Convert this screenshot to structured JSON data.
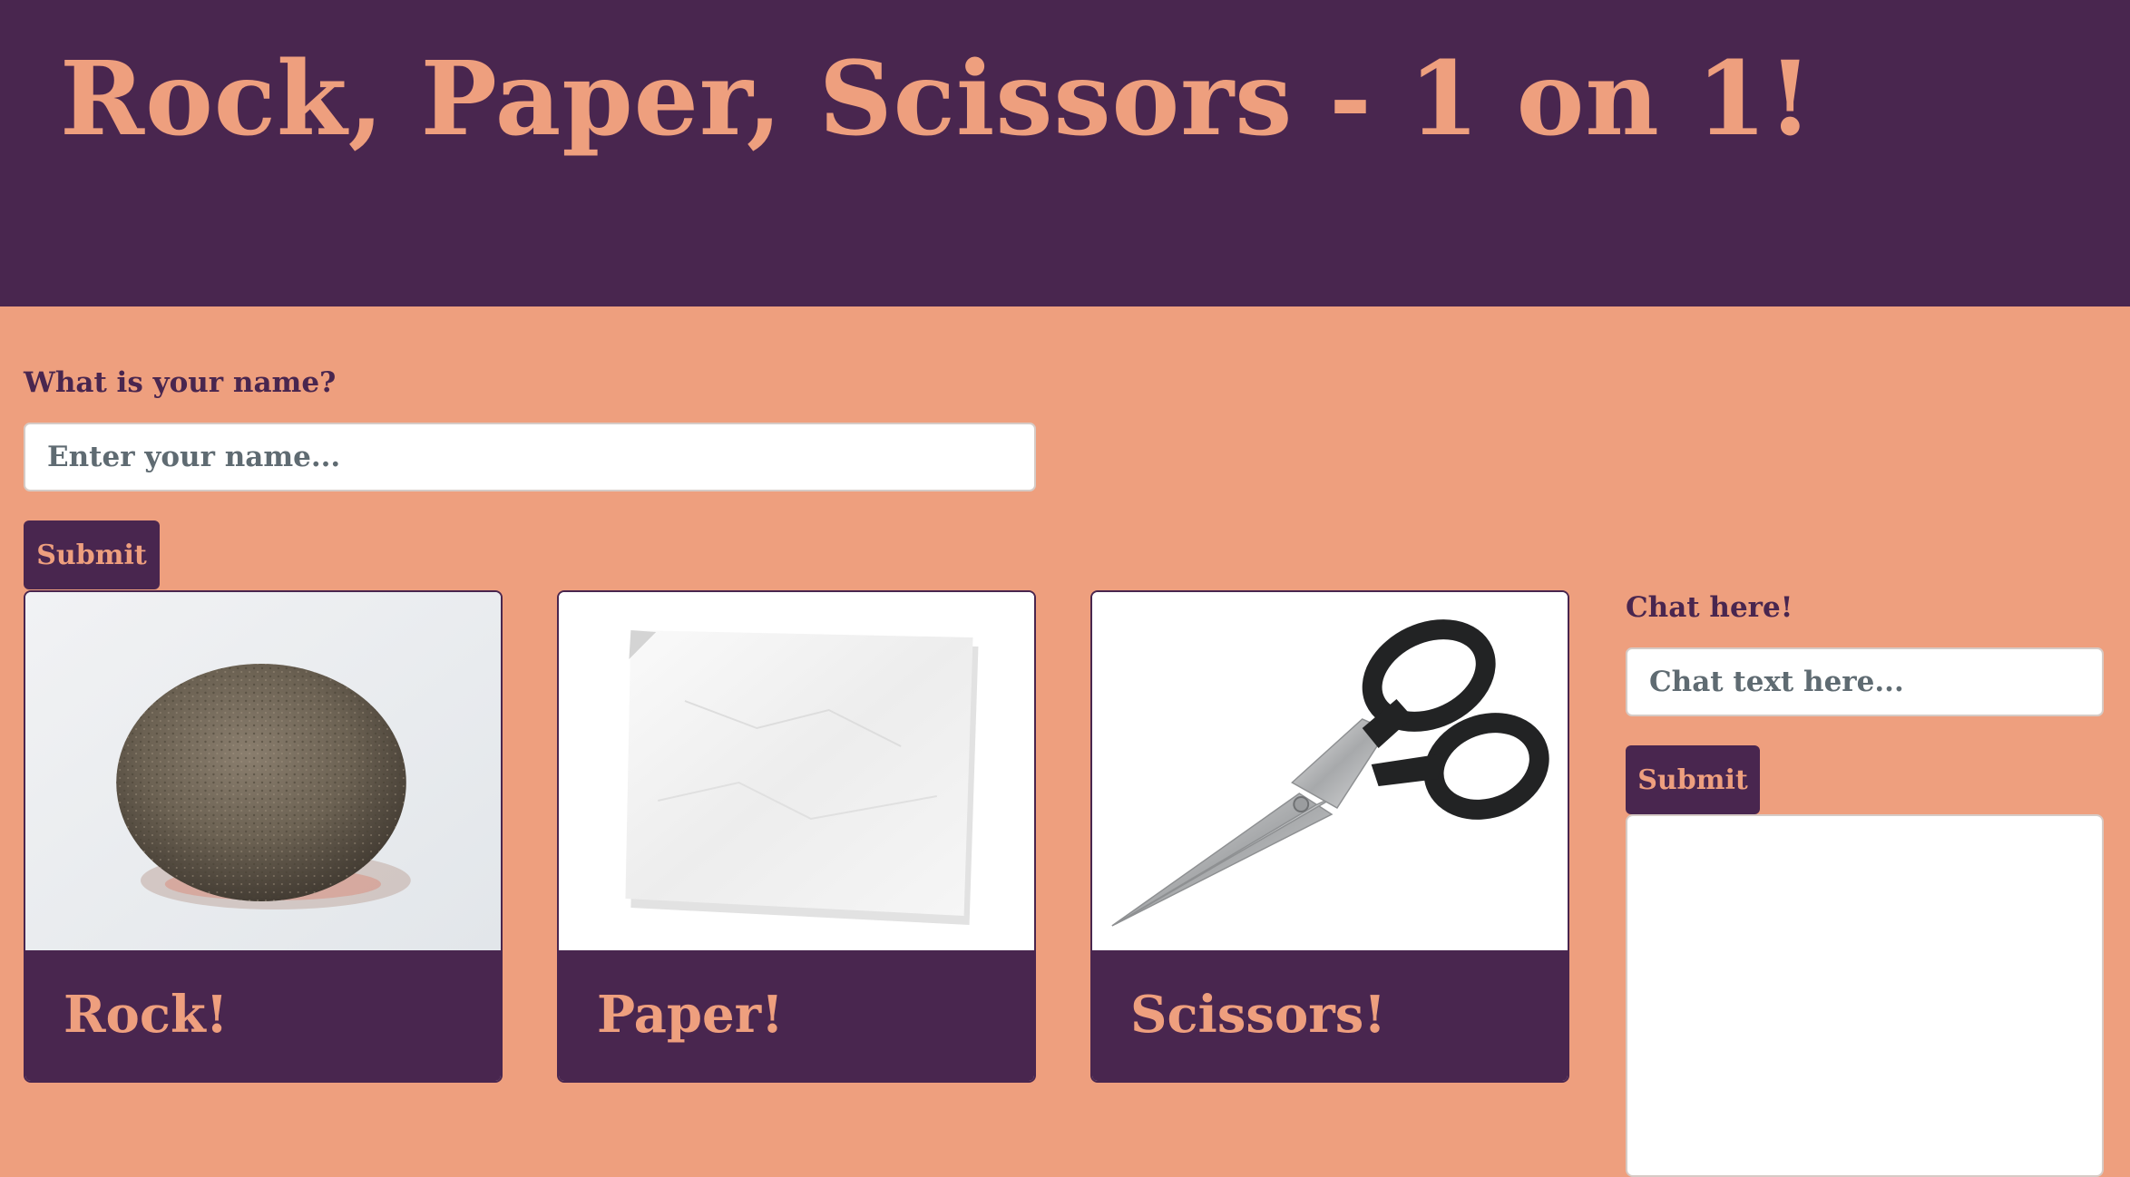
{
  "header": {
    "title": "Rock, Paper, Scissors - 1 on 1!"
  },
  "name_form": {
    "label": "What is your name?",
    "placeholder": "Enter your name...",
    "value": "",
    "submit_label": "Submit"
  },
  "choices": [
    {
      "label": "Rock!",
      "image": "rock"
    },
    {
      "label": "Paper!",
      "image": "paper"
    },
    {
      "label": "Scissors!",
      "image": "scissors"
    }
  ],
  "chat": {
    "label": "Chat here!",
    "placeholder": "Chat text here...",
    "value": "",
    "submit_label": "Submit",
    "messages": []
  },
  "colors": {
    "primary": "#49264F",
    "accent": "#EE9F7E",
    "card_background": "#FFFFFF"
  }
}
